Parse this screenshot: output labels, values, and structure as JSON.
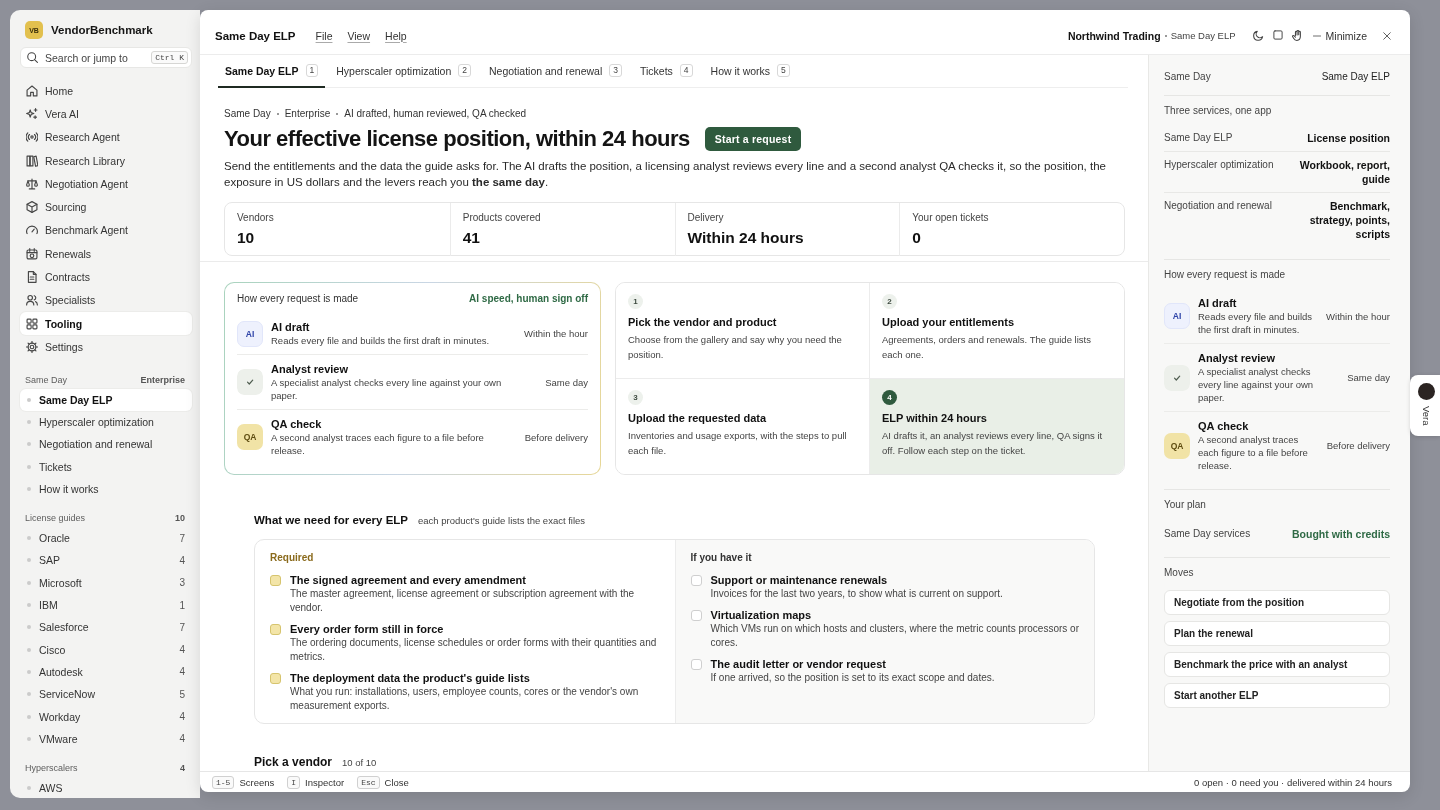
{
  "window": {
    "title": "Same Day ELP",
    "menu": [
      "File",
      "View",
      "Help"
    ],
    "account": "Northwind Trading",
    "context": "Same Day ELP",
    "minimize": "Minimize"
  },
  "sidebar": {
    "brand": {
      "logo": "VB",
      "name": "VendorBenchmark"
    },
    "search": {
      "placeholder": "Search or jump to",
      "shortcut": "Ctrl K"
    },
    "nav": [
      {
        "label": "Home",
        "selected": false
      },
      {
        "label": "Vera AI",
        "selected": false
      },
      {
        "label": "Research Agent",
        "selected": false
      },
      {
        "label": "Research Library",
        "selected": false
      },
      {
        "label": "Negotiation Agent",
        "selected": false
      },
      {
        "label": "Sourcing",
        "selected": false
      },
      {
        "label": "Benchmark Agent",
        "selected": false
      },
      {
        "label": "Renewals",
        "selected": false
      },
      {
        "label": "Contracts",
        "selected": false
      },
      {
        "label": "Specialists",
        "selected": false
      },
      {
        "label": "Tooling",
        "selected": true
      },
      {
        "label": "Settings",
        "selected": false
      }
    ],
    "sections": [
      {
        "title": "Same Day",
        "aside": "Enterprise",
        "items": [
          {
            "label": "Same Day ELP",
            "selected": true
          },
          {
            "label": "Hyperscaler optimization",
            "selected": false
          },
          {
            "label": "Negotiation and renewal",
            "selected": false
          },
          {
            "label": "Tickets",
            "selected": false
          },
          {
            "label": "How it works",
            "selected": false
          }
        ]
      },
      {
        "title": "License guides",
        "aside": "10",
        "items": [
          {
            "label": "Oracle",
            "count": "7",
            "selected": false
          },
          {
            "label": "SAP",
            "count": "4",
            "selected": false
          },
          {
            "label": "Microsoft",
            "count": "3",
            "selected": false
          },
          {
            "label": "IBM",
            "count": "1",
            "selected": false
          },
          {
            "label": "Salesforce",
            "count": "7",
            "selected": false
          },
          {
            "label": "Cisco",
            "count": "4",
            "selected": false
          },
          {
            "label": "Autodesk",
            "count": "4",
            "selected": false
          },
          {
            "label": "ServiceNow",
            "count": "5",
            "selected": false
          },
          {
            "label": "Workday",
            "count": "4",
            "selected": false
          },
          {
            "label": "VMware",
            "count": "4",
            "selected": false
          }
        ]
      },
      {
        "title": "Hyperscalers",
        "aside": "4",
        "items": [
          {
            "label": "AWS",
            "selected": false
          }
        ]
      }
    ]
  },
  "tabs": [
    {
      "label": "Same Day ELP",
      "key": "1",
      "selected": true
    },
    {
      "label": "Hyperscaler optimization",
      "key": "2",
      "selected": false
    },
    {
      "label": "Negotiation and renewal",
      "key": "3",
      "selected": false
    },
    {
      "label": "Tickets",
      "key": "4",
      "selected": false
    },
    {
      "label": "How it works",
      "key": "5",
      "selected": false
    }
  ],
  "hero": {
    "breadcrumb": [
      "Same Day",
      "Enterprise",
      "AI drafted, human reviewed, QA checked"
    ],
    "title": "Your effective license position, within 24 hours",
    "action": "Start a request",
    "intro": "Send the entitlements and the data the guide asks for. The AI drafts the position, a licensing analyst reviews every line and a second analyst QA checks it, so the position, the exposure in US dollars and the levers reach you **the same day**.",
    "stats": [
      {
        "label": "Vendors",
        "value": "10"
      },
      {
        "label": "Products covered",
        "value": "41"
      },
      {
        "label": "Delivery",
        "value": "Within 24 hours"
      },
      {
        "label": "Your open tickets",
        "value": "0"
      }
    ]
  },
  "process": {
    "title": "How every request is made",
    "tagline": "AI speed, human sign off",
    "stages": [
      {
        "kind": "ai",
        "badge": "AI",
        "title": "AI draft",
        "text": "Reads every file and builds the first draft in minutes.",
        "timing": "Within the hour"
      },
      {
        "kind": "review",
        "title": "Analyst review",
        "text": "A specialist analyst checks every line against your own paper.",
        "timing": "Same day"
      },
      {
        "kind": "qa",
        "badge": "QA",
        "title": "QA check",
        "text": "A second analyst traces each figure to a file before release.",
        "timing": "Before delivery"
      }
    ]
  },
  "steps": [
    {
      "number": "1",
      "title": "Pick the vendor and product",
      "text": "Choose from the gallery and say why you need the position.",
      "current": false
    },
    {
      "number": "2",
      "title": "Upload your entitlements",
      "text": "Agreements, orders and renewals. The guide lists each one.",
      "current": false
    },
    {
      "number": "3",
      "title": "Upload the requested data",
      "text": "Inventories and usage exports, with the steps to pull each file.",
      "current": false
    },
    {
      "number": "4",
      "title": "ELP within 24 hours",
      "text": "AI drafts it, an analyst reviews every line, QA signs it off. Follow each step on the ticket.",
      "current": true
    }
  ],
  "requirements": {
    "title": "What we need for every ELP",
    "hint": "each product's guide lists the exact files",
    "columns": [
      {
        "kind": "required",
        "title": "Required",
        "items": [
          {
            "title": "The signed agreement and every amendment",
            "text": "The master agreement, license agreement or subscription agreement with the vendor.",
            "checked": false
          },
          {
            "title": "Every order form still in force",
            "text": "The ordering documents, license schedules or order forms with their quantities and metrics.",
            "checked": false
          },
          {
            "title": "The deployment data the product's guide lists",
            "text": "What you run: installations, users, employee counts, cores or the vendor's own measurement exports.",
            "checked": false
          }
        ]
      },
      {
        "kind": "optional",
        "title": "If you have it",
        "items": [
          {
            "title": "Support or maintenance renewals",
            "text": "Invoices for the last two years, to show what is current on support.",
            "checked": false
          },
          {
            "title": "Virtualization maps",
            "text": "Which VMs run on which hosts and clusters, where the metric counts processors or cores.",
            "checked": false
          },
          {
            "title": "The audit letter or vendor request",
            "text": "If one arrived, so the position is set to its exact scope and dates.",
            "checked": false
          }
        ]
      }
    ]
  },
  "vendors": {
    "title": "Pick a vendor",
    "count": "10 of 10"
  },
  "panel": {
    "header": {
      "label": "Same Day",
      "value": "Same Day ELP"
    },
    "services": {
      "title": "Three services, one app",
      "rows": [
        {
          "label": "Same Day ELP",
          "value": "License position"
        },
        {
          "label": "Hyperscaler optimization",
          "value": "Workbook, report, guide"
        },
        {
          "label": "Negotiation and renewal",
          "value": "Benchmark, strategy, points, scripts"
        }
      ]
    },
    "process": {
      "title": "How every request is made",
      "stages": [
        {
          "kind": "ai",
          "badge": "AI",
          "title": "AI draft",
          "text": "Reads every file and builds the first draft in minutes.",
          "timing": "Within the hour"
        },
        {
          "kind": "review",
          "title": "Analyst review",
          "text": "A specialist analyst checks every line against your own paper.",
          "timing": "Same day"
        },
        {
          "kind": "qa",
          "badge": "QA",
          "title": "QA check",
          "text": "A second analyst traces each figure to a file before release.",
          "timing": "Before delivery"
        }
      ]
    },
    "plan": {
      "title": "Your plan",
      "label": "Same Day services",
      "value": "Bought with credits"
    },
    "moves": {
      "title": "Moves",
      "actions": [
        "Negotiate from the position",
        "Plan the renewal",
        "Benchmark the price with an analyst",
        "Start another ELP"
      ]
    }
  },
  "footer": {
    "shortcuts": [
      {
        "key": "1-5",
        "label": "Screens"
      },
      {
        "key": "I",
        "label": "Inspector"
      },
      {
        "key": "Esc",
        "label": "Close"
      }
    ],
    "status": "0 open · 0 need you · delivered within 24 hours"
  },
  "assistant": {
    "label": "Vera"
  }
}
